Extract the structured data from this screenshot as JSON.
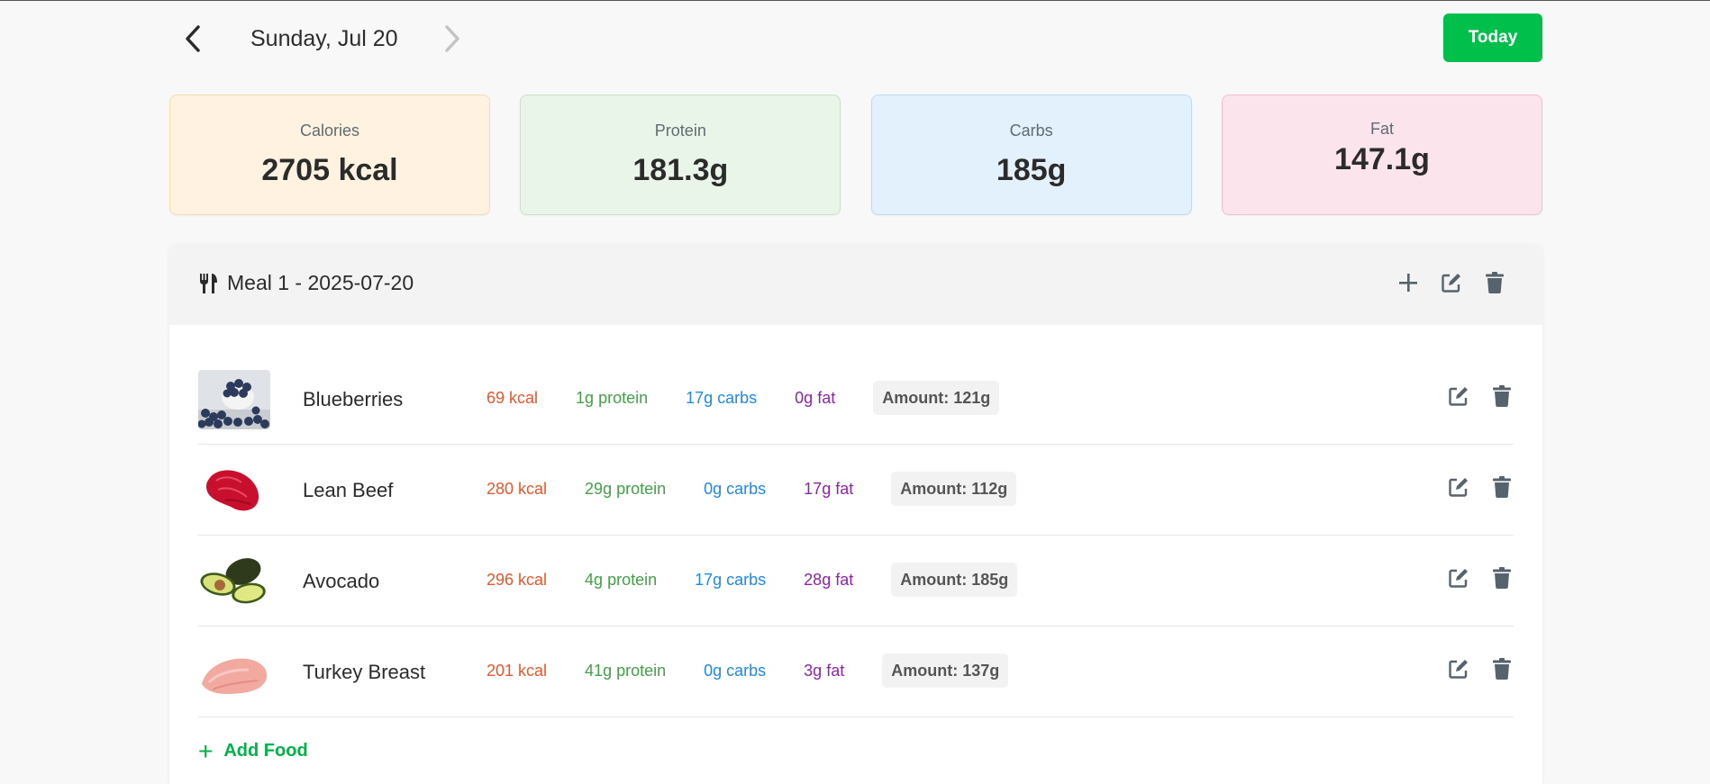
{
  "date_nav": {
    "date_label": "Sunday, Jul 20",
    "today_label": "Today"
  },
  "summary": {
    "calories": {
      "label": "Calories",
      "value": "2705 kcal"
    },
    "protein": {
      "label": "Protein",
      "value": "181.3g"
    },
    "carbs": {
      "label": "Carbs",
      "value": "185g"
    },
    "fat": {
      "label": "Fat",
      "value": "147.1g"
    }
  },
  "meal": {
    "title": "Meal 1 - 2025-07-20",
    "foods": [
      {
        "name": "Blueberries",
        "kcal": "69 kcal",
        "protein": "1g protein",
        "carbs": "17g carbs",
        "fat": "0g fat",
        "amount": "Amount: 121g",
        "image": "blueberries"
      },
      {
        "name": "Lean Beef",
        "kcal": "280 kcal",
        "protein": "29g protein",
        "carbs": "0g carbs",
        "fat": "17g fat",
        "amount": "Amount: 112g",
        "image": "beef"
      },
      {
        "name": "Avocado",
        "kcal": "296 kcal",
        "protein": "4g protein",
        "carbs": "17g carbs",
        "fat": "28g fat",
        "amount": "Amount: 185g",
        "image": "avocado"
      },
      {
        "name": "Turkey Breast",
        "kcal": "201 kcal",
        "protein": "41g protein",
        "carbs": "0g carbs",
        "fat": "3g fat",
        "amount": "Amount: 137g",
        "image": "turkey"
      }
    ],
    "add_food_label": "Add Food"
  },
  "colors": {
    "accent": "#00c04b",
    "kcal": "#e8562a",
    "protein": "#43a047",
    "carbs": "#1e88e5",
    "fat": "#8e24aa"
  },
  "icons": [
    "chevron-left-icon",
    "chevron-right-icon",
    "utensils-icon",
    "plus-icon",
    "edit-icon",
    "trash-icon"
  ]
}
